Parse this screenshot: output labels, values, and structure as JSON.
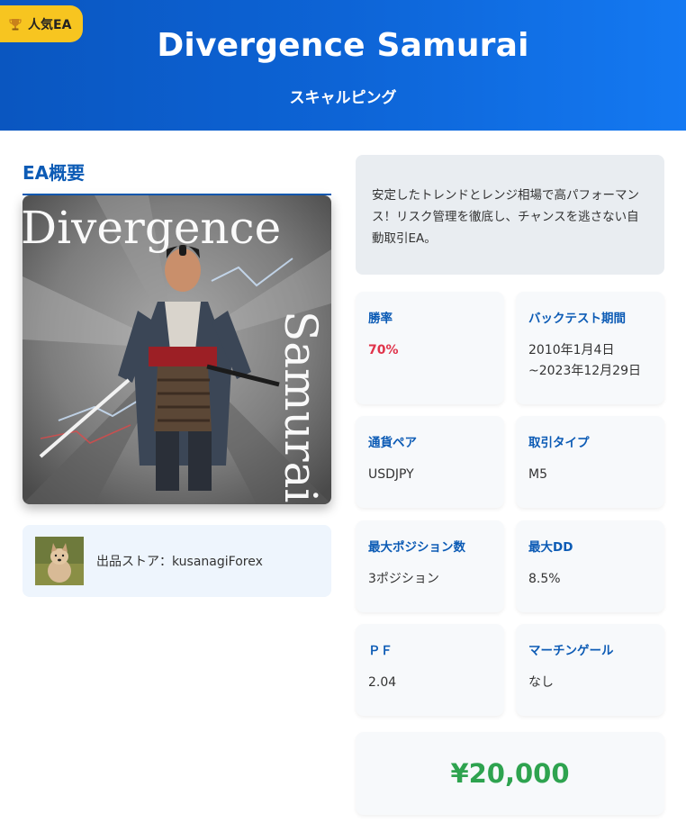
{
  "badge": {
    "icon": "trophy-icon",
    "label": "人気EA"
  },
  "header": {
    "title": "Divergence Samurai",
    "subtitle": "スキャルピング"
  },
  "overview": {
    "title": "EA概要"
  },
  "hero_image": {
    "word_top": "Divergence",
    "word_side": "Samurai"
  },
  "store": {
    "label": "出品ストア：kusanagiForex",
    "avatar_icon": "dog-avatar"
  },
  "description": "安定したトレンドとレンジ相場で高パフォーマンス！リスク管理を徹底し、チャンスを逃さない自動取引EA。",
  "stats": {
    "win_rate": {
      "label": "勝率",
      "value": "70%"
    },
    "backtest": {
      "label": "バックテスト期間",
      "value": "2010年1月4日~2023年12月29日"
    },
    "pair": {
      "label": "通貨ペア",
      "value": "USDJPY"
    },
    "trade_type": {
      "label": "取引タイプ",
      "value": "M5"
    },
    "max_positions": {
      "label": "最大ポジション数",
      "value": "3ポジション"
    },
    "max_dd": {
      "label": "最大DD",
      "value": "8.5%"
    },
    "pf": {
      "label": "ＰＦ",
      "value": "2.04"
    },
    "martingale": {
      "label": "マーチンゲール",
      "value": "なし"
    }
  },
  "price": "¥20,000",
  "colors": {
    "header_start": "#0a56c0",
    "header_end": "#1479f2",
    "accent": "#0c5bb5",
    "badge": "#f7c520",
    "win_rate": "#e0334a",
    "price": "#2ea34f"
  }
}
